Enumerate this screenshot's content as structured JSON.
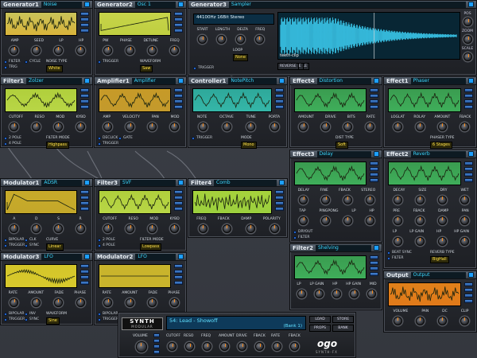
{
  "colors": {
    "accent": "#1ea0ff",
    "preset_text": "#3cd8ff",
    "selector_text": "#ffe14a",
    "knob_pointer": "#ff8a1a"
  },
  "modules": {
    "gen1": {
      "name": "Generator1",
      "preset": "Noise",
      "knobs": [
        "AMP",
        "SEED",
        "LP",
        "HP"
      ],
      "opts": [
        "FILTER",
        "TRIG",
        "CYCLE"
      ],
      "sel_cap": "NOISE TYPE",
      "sel": "White"
    },
    "gen2": {
      "name": "Generator2",
      "preset": "Osc 1",
      "knobs": [
        "PW",
        "PHASE",
        "DETUNE",
        "FREQ"
      ],
      "opts": [
        "TRIGGER"
      ],
      "sel_cap": "WAVEFORM",
      "sel": "Saw"
    },
    "gen3": {
      "name": "Generator3",
      "preset": "Sampler",
      "knobs": [
        "START",
        "LENGTH",
        "DELTA",
        "FREQ"
      ],
      "opts": [
        "TRIGGER"
      ],
      "sel_cap": "LOOP",
      "sel": "None",
      "info": "44100Hz 16Bit Stereo",
      "sample_name": "teeth-clip",
      "btns": [
        "LOAD SAMPLE",
        "CLEAR SAMPLE",
        "NORMALIZE",
        "REVERSE"
      ],
      "side": [
        "POS",
        "ZOOM",
        "SCALE"
      ]
    },
    "fil1": {
      "name": "Filter1",
      "preset": "Zolzer",
      "knobs": [
        "CUTOFF",
        "RESO",
        "MOD",
        "KYBD"
      ],
      "opts": [
        "2 POLE",
        "4 POLE"
      ],
      "sel_cap": "FILTER MODE",
      "sel": "Highpass"
    },
    "amp1": {
      "name": "Amplifier1",
      "preset": "Amplifier",
      "knobs": [
        "AMP",
        "VELOCITY",
        "PAN",
        "MOD"
      ],
      "opts": [
        "DECLICK",
        "TRIGGER",
        "GATE"
      ]
    },
    "ctl1": {
      "name": "Controller1",
      "preset": "NotePitch",
      "knobs": [
        "NOTE",
        "OCTAVE",
        "TUNE",
        "PORTA"
      ],
      "opts": [
        "TRIGGER"
      ],
      "sel_cap": "MODE",
      "sel": "Mono"
    },
    "eff4": {
      "name": "Effect4",
      "preset": "Distortion",
      "knobs": [
        "AMOUNT",
        "DRIVE",
        "BITS",
        "RATE"
      ],
      "sel_cap": "DIST TYPE",
      "sel": "Soft"
    },
    "eff1": {
      "name": "Effect1",
      "preset": "Phaser",
      "knobs": [
        "LOGLAT",
        "ROLAY",
        "AMOUNT",
        "FBACK"
      ],
      "sel_cap": "PHASER TYPE",
      "sel": "6 Stages"
    },
    "eff3": {
      "name": "Effect3",
      "preset": "Delay",
      "knobs": [
        "DELAY",
        "FINE",
        "FBACK",
        "STEREO"
      ],
      "knobs2": [
        "TAP",
        "PINGPONG",
        "LP",
        "HP"
      ],
      "opts": [
        "DRYOUT",
        "FILTER"
      ]
    },
    "eff2": {
      "name": "Effect2",
      "preset": "Reverb",
      "knobs": [
        "DECAY",
        "SIZE",
        "DRY",
        "WET"
      ],
      "knobs2": [
        "PRE",
        "FBACK",
        "DAMP",
        "PAN"
      ],
      "knobs3": [
        "LP",
        "LP GAIN",
        "HP",
        "HP GAIN"
      ],
      "opts": [
        "BEAT SYNC",
        "FILTER"
      ],
      "sel_cap": "REVERB TYPE",
      "sel": "BigHall"
    },
    "mod1": {
      "name": "Modulator1",
      "preset": "ADSR",
      "knobs": [
        "A",
        "D",
        "S",
        "R"
      ],
      "opts": [
        "BIPOLAR",
        "TRIGGER",
        "CLK",
        "SYNC"
      ],
      "sel_cap": "CURVE",
      "sel": "Linear"
    },
    "fil3": {
      "name": "Filter3",
      "preset": "SVF",
      "knobs": [
        "CUTOFF",
        "RESO",
        "MOD",
        "KYBD"
      ],
      "opts": [
        "2 POLE",
        "4 POLE"
      ],
      "sel_cap": "FILTER MODE",
      "sel": "Lowpass"
    },
    "fil4": {
      "name": "Filter4",
      "preset": "Comb",
      "knobs": [
        "FREQ",
        "FBACK",
        "DAMP",
        "POLARITY"
      ]
    },
    "fil2": {
      "name": "Filter2",
      "preset": "Shelving",
      "knobs": [
        "LP",
        "LP GAIN",
        "HP",
        "HP GAIN",
        "MID"
      ]
    },
    "mod3": {
      "name": "Modulator3",
      "preset": "LFO",
      "knobs": [
        "RATE",
        "AMOUNT",
        "FADE",
        "PHASE"
      ],
      "opts": [
        "BIPOLAR",
        "TRIGGER",
        "INV",
        "SYNC"
      ],
      "sel_cap": "WAVEFORM",
      "sel": "Sine"
    },
    "mod2": {
      "name": "Modulator2",
      "preset": "LFO",
      "knobs": [
        "RATE",
        "AMOUNT",
        "FADE",
        "PHASE"
      ],
      "opts": [
        "BIPOLAR",
        "TRIGGER"
      ]
    },
    "out": {
      "name": "Output",
      "preset": "Output",
      "knobs": [
        "VOLUME",
        "PAN",
        "DC",
        "CLIP"
      ]
    }
  },
  "bar": {
    "logo_top": "SYNTH",
    "logo_bottom": "MODULAR",
    "patch": "54: Lead - Showoff",
    "bank": "(Bank 1)",
    "btns": [
      "LOAD",
      "STORE",
      "PROPS",
      "BANK"
    ],
    "knob_volume": "VOLUME",
    "knobs": [
      "CUTOFF",
      "RESO",
      "FREQ",
      "AMOUNT",
      "DRIVE",
      "FBACK",
      "RATE",
      "FBACK"
    ],
    "brand": "ogo",
    "brand_sub": "SYNTH-FX"
  }
}
